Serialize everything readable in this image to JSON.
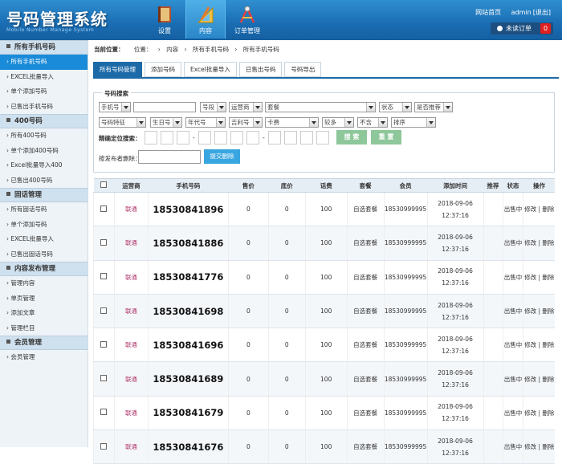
{
  "app": {
    "title": "号码管理系统",
    "subtitle": "Mobile Number Manage System"
  },
  "nav": [
    {
      "label": "设置",
      "icon": "book-icon"
    },
    {
      "label": "内容",
      "icon": "pencil-ruler-icon"
    },
    {
      "label": "订单管理",
      "icon": "compass-icon"
    }
  ],
  "top_links": {
    "home": "网站首页",
    "user": "admin",
    "logout": "[退出]"
  },
  "unread": {
    "label": "未读订单",
    "count": "0"
  },
  "sidebar": [
    {
      "title": "所有手机号码",
      "items": [
        "所有手机号码",
        "EXCEL批量导入",
        "单个添加号码",
        "已售出手机号码"
      ]
    },
    {
      "title": "400号码",
      "items": [
        "所有400号码",
        "单个添加400号码",
        "Excel批量导入400",
        "已售出400号码"
      ]
    },
    {
      "title": "固话管理",
      "items": [
        "所有固话号码",
        "单个添加号码",
        "EXCEL批量导入",
        "已售出固话号码"
      ]
    },
    {
      "title": "内容发布管理",
      "items": [
        "管理内容",
        "单页管理",
        "添加文章",
        "管理栏目"
      ]
    },
    {
      "title": "会员管理",
      "items": [
        "会员管理"
      ]
    }
  ],
  "breadcrumb": {
    "label": "当前位置：",
    "parts": [
      "位置：",
      "›",
      "内容",
      "›",
      "所有手机号码",
      "›",
      "所有手机号码"
    ]
  },
  "tabs": [
    "所有号码管理",
    "添加号码",
    "Excel批量导入",
    "已售出号码",
    "号码导出"
  ],
  "search": {
    "legend": "号码搜索",
    "row1": [
      "手机号",
      "号段",
      "运营商",
      "套餐",
      "状态",
      "是否推荐"
    ],
    "row2": [
      "号码特征",
      "生日号",
      "年代号",
      "吉利号",
      "卡费",
      "较多",
      "不含",
      "排序"
    ],
    "exact_label": "精确定位搜索：",
    "dash": "-",
    "search_btn": "搜 索",
    "reset_btn": "重 置",
    "delete_label": "按发布者删除：",
    "delete_btn": "提交删除"
  },
  "table": {
    "headers": [
      "",
      "运营商",
      "手机号码",
      "售价",
      "底价",
      "话费",
      "套餐",
      "会员",
      "添加时间",
      "推荐",
      "状态",
      "操作"
    ],
    "rows": [
      {
        "carrier": "联通",
        "phone": "18530841896",
        "price": "0",
        "floor": "0",
        "fee": "100",
        "plan": "自选套餐",
        "member": "18530999995",
        "date": "2018-09-06",
        "time": "12:37:16",
        "rec": "",
        "status": "出售中",
        "ops": "修改 | 删除"
      },
      {
        "carrier": "联通",
        "phone": "18530841886",
        "price": "0",
        "floor": "0",
        "fee": "100",
        "plan": "自选套餐",
        "member": "18530999995",
        "date": "2018-09-06",
        "time": "12:37:16",
        "rec": "",
        "status": "出售中",
        "ops": "修改 | 删除"
      },
      {
        "carrier": "联通",
        "phone": "18530841776",
        "price": "0",
        "floor": "0",
        "fee": "100",
        "plan": "自选套餐",
        "member": "18530999995",
        "date": "2018-09-06",
        "time": "12:37:16",
        "rec": "",
        "status": "出售中",
        "ops": "修改 | 删除"
      },
      {
        "carrier": "联通",
        "phone": "18530841698",
        "price": "0",
        "floor": "0",
        "fee": "100",
        "plan": "自选套餐",
        "member": "18530999995",
        "date": "2018-09-06",
        "time": "12:37:16",
        "rec": "",
        "status": "出售中",
        "ops": "修改 | 删除"
      },
      {
        "carrier": "联通",
        "phone": "18530841696",
        "price": "0",
        "floor": "0",
        "fee": "100",
        "plan": "自选套餐",
        "member": "18530999995",
        "date": "2018-09-06",
        "time": "12:37:16",
        "rec": "",
        "status": "出售中",
        "ops": "修改 | 删除"
      },
      {
        "carrier": "联通",
        "phone": "18530841689",
        "price": "0",
        "floor": "0",
        "fee": "100",
        "plan": "自选套餐",
        "member": "18530999995",
        "date": "2018-09-06",
        "time": "12:37:16",
        "rec": "",
        "status": "出售中",
        "ops": "修改 | 删除"
      },
      {
        "carrier": "联通",
        "phone": "18530841679",
        "price": "0",
        "floor": "0",
        "fee": "100",
        "plan": "自选套餐",
        "member": "18530999995",
        "date": "2018-09-06",
        "time": "12:37:16",
        "rec": "",
        "status": "出售中",
        "ops": "修改 | 删除"
      },
      {
        "carrier": "联通",
        "phone": "18530841676",
        "price": "0",
        "floor": "0",
        "fee": "100",
        "plan": "自选套餐",
        "member": "18530999995",
        "date": "2018-09-06",
        "time": "12:37:16",
        "rec": "",
        "status": "出售中",
        "ops": "修改 | 删除"
      }
    ]
  },
  "colors": {
    "header": "#1a6db3",
    "active": "#1a8bd9",
    "tab_active": "#1d6aa8",
    "search_btn": "#8dc79a",
    "submit_btn": "#3aa6e0"
  }
}
